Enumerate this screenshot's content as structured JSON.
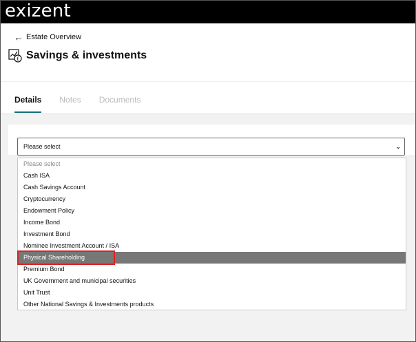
{
  "brand": {
    "logo_text": "exizent"
  },
  "nav": {
    "back_label": "Estate Overview"
  },
  "page": {
    "title": "Savings & investments"
  },
  "tabs": [
    {
      "label": "Details",
      "active": true
    },
    {
      "label": "Notes",
      "active": false
    },
    {
      "label": "Documents",
      "active": false
    }
  ],
  "select": {
    "value": "Please select",
    "options": [
      "Please select",
      "Cash ISA",
      "Cash Savings Account",
      "Cryptocurrency",
      "Endowment Policy",
      "Income Bond",
      "Investment Bond",
      "Nominee Investment Account / ISA",
      "Physical Shareholding",
      "Premium Bond",
      "UK Government and municipal securities",
      "Unit Trust",
      "Other National Savings & Investments products"
    ],
    "highlighted_index": 8
  },
  "colors": {
    "accent": "#0f6f78",
    "highlight": "#777777",
    "annotation": "#e02020"
  }
}
